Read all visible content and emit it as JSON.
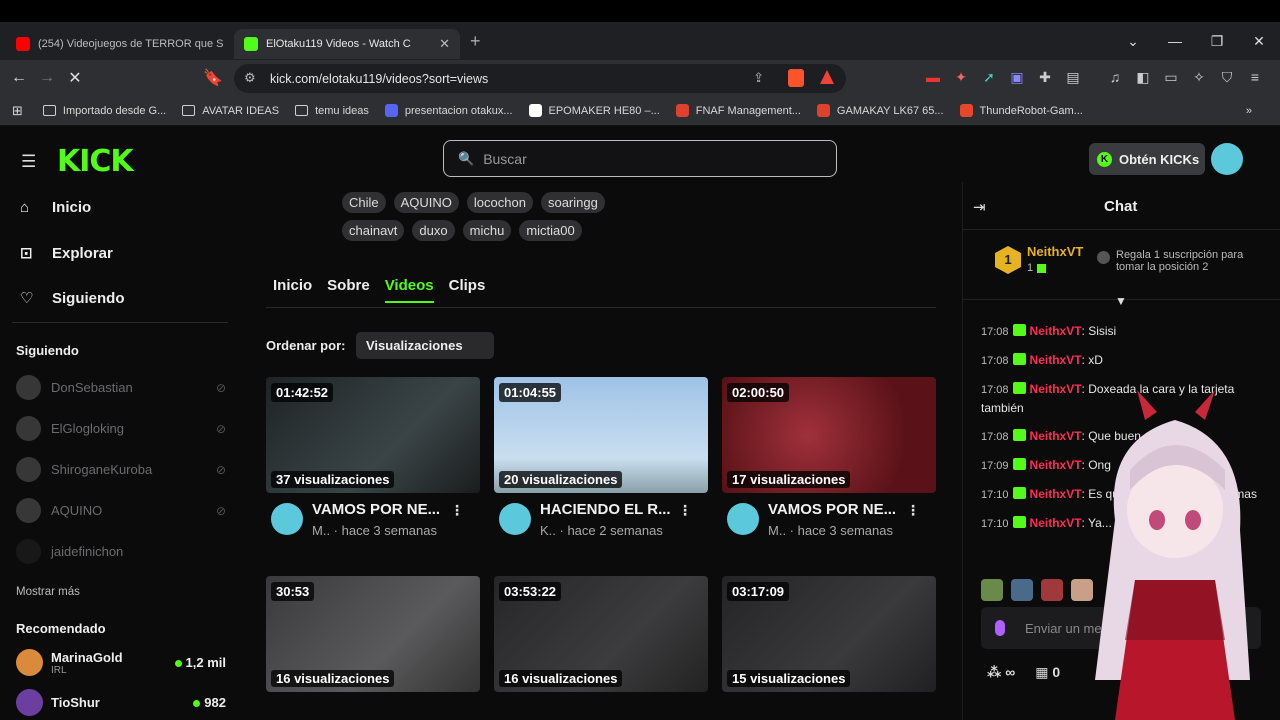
{
  "browser": {
    "tabs": [
      {
        "title": "(254) Videojuegos de TERROR que S",
        "favicon_color": "#ff0000"
      },
      {
        "title": "ElOtaku119 Videos - Watch C",
        "favicon_color": "#53fc18"
      }
    ],
    "url": "kick.com/elotaku119/videos?sort=views",
    "bookmarks": [
      {
        "label": "Importado desde G...",
        "type": "folder"
      },
      {
        "label": "AVATAR IDEAS",
        "type": "folder"
      },
      {
        "label": "temu ideas",
        "type": "folder"
      },
      {
        "label": "presentacion otakux...",
        "type": "site",
        "color": "#5865f2"
      },
      {
        "label": "EPOMAKER HE80 –...",
        "type": "site",
        "color": "#ffffff"
      },
      {
        "label": "FNAF Management...",
        "type": "site",
        "color": "#e0402e"
      },
      {
        "label": "GAMAKAY LK67 65...",
        "type": "site",
        "color": "#e0402e"
      },
      {
        "label": "ThundeRobot-Gam...",
        "type": "site",
        "color": "#e8462b"
      }
    ]
  },
  "header": {
    "logo": "KICK",
    "search_placeholder": "Buscar",
    "get_kicks_label": "Obtén KICKs"
  },
  "sidebar": {
    "nav": [
      {
        "label": "Inicio",
        "icon": "home-icon"
      },
      {
        "label": "Explorar",
        "icon": "explore-icon"
      },
      {
        "label": "Siguiendo",
        "icon": "heart-icon"
      }
    ],
    "following_title": "Siguiendo",
    "following": [
      "DonSebastian",
      "ElGlogloking",
      "ShiroganeKuroba",
      "AQUINO",
      "jaidefinichon"
    ],
    "show_more": "Mostrar más",
    "recommended_title": "Recomendado",
    "recommended": [
      {
        "name": "MarinaGold",
        "category": "IRL",
        "viewers": "1,2 mil"
      },
      {
        "name": "TioShur",
        "category": "",
        "viewers": "982"
      }
    ]
  },
  "channel": {
    "tags_row1": [
      "Chile",
      "AQUINO",
      "locochon",
      "soaringg"
    ],
    "tags_row2": [
      "chainavt",
      "duxo",
      "michu",
      "mictia00"
    ],
    "tabs": [
      "Inicio",
      "Sobre",
      "Videos",
      "Clips"
    ],
    "active_tab": "Videos",
    "sort_label": "Ordenar por:",
    "sort_value": "Visualizaciones"
  },
  "videos": [
    {
      "duration": "01:42:52",
      "views": "37 visualizaciones",
      "title": "VAMOS POR NE...",
      "sub": "M.. · hace 3 semanas",
      "thumb": "#1e2426"
    },
    {
      "duration": "01:04:55",
      "views": "20 visualizaciones",
      "title": "HACIENDO EL R...",
      "sub": "K.. · hace 2 semanas",
      "thumb": "#a8cce8"
    },
    {
      "duration": "02:00:50",
      "views": "17 visualizaciones",
      "title": "VAMOS POR NE...",
      "sub": "M.. · hace 3 semanas",
      "thumb": "#6e1a20"
    },
    {
      "duration": "30:53",
      "views": "16 visualizaciones",
      "title": "",
      "sub": "",
      "thumb": "#4a4a4c"
    },
    {
      "duration": "03:53:22",
      "views": "16 visualizaciones",
      "title": "",
      "sub": "",
      "thumb": "#2e2e30"
    },
    {
      "duration": "03:17:09",
      "views": "15 visualizaciones",
      "title": "",
      "sub": "",
      "thumb": "#2a2a2c"
    }
  ],
  "chat": {
    "title": "Chat",
    "pinned_user": "NeithxVT",
    "pinned_rank": "1",
    "pinned_count": "1",
    "gift_text": "Regala 1 suscripción para tomar la posición 2",
    "messages": [
      {
        "time": "17:08",
        "user": "NeithxVT",
        "text": ": Sisisi"
      },
      {
        "time": "17:08",
        "user": "NeithxVT",
        "text": ": xD"
      },
      {
        "time": "17:08",
        "user": "NeithxVT",
        "text": ": Doxeada la cara y la tarjeta también"
      },
      {
        "time": "17:08",
        "user": "NeithxVT",
        "text": ": Que buen servicio"
      },
      {
        "time": "17:09",
        "user": "NeithxVT",
        "text": ": Ong"
      },
      {
        "time": "17:10",
        "user": "NeithxVT",
        "text": ": Es que si kick tiene más formas"
      },
      {
        "time": "17:10",
        "user": "NeithxVT",
        "text": ": Ya... sjdjjsd"
      }
    ],
    "input_placeholder": "Enviar un mensaje",
    "footer_points": "∞",
    "footer_store": "0"
  }
}
